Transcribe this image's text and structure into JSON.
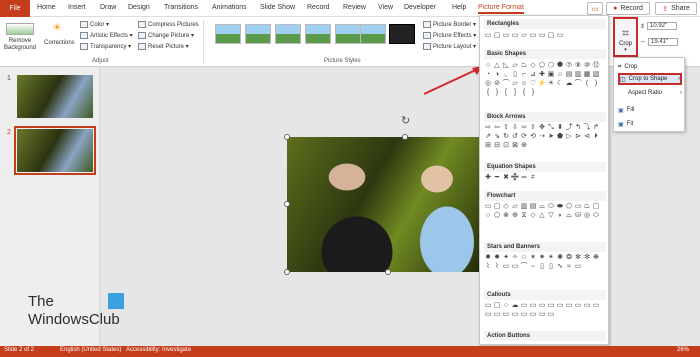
{
  "tabs": {
    "file": "File",
    "items": [
      "Home",
      "Insert",
      "Draw",
      "Design",
      "Transitions",
      "Animations",
      "Slide Show",
      "Record",
      "Review",
      "View",
      "Developer",
      "Help",
      "Picture Format"
    ],
    "record": "Record",
    "share": "Share"
  },
  "ribbon": {
    "remove_bg": "Remove\nBackground",
    "corrections": "Corrections",
    "color": "Color ▾",
    "artistic": "Artistic Effects ▾",
    "transparency": "Transparency ▾",
    "compress": "Compress Pictures",
    "change": "Change Picture ▾",
    "reset": "Reset Picture ▾",
    "group_adjust": "Adjust",
    "group_styles": "Picture Styles",
    "border": "Picture Border ▾",
    "effects": "Picture Effects ▾",
    "layout": "Picture Layout ▾",
    "height": "10.92\"",
    "width": "19.41\""
  },
  "crop": {
    "button": "Crop",
    "items": [
      "Crop",
      "Crop to Shape",
      "Aspect Ratio",
      "Fill",
      "Fit"
    ]
  },
  "shapes": {
    "sections": [
      "Rectangles",
      "Basic Shapes",
      "Block Arrows",
      "Equation Shapes",
      "Flowchart",
      "Stars and Banners",
      "Callouts",
      "Action Buttons"
    ]
  },
  "slides": [
    "1",
    "2"
  ],
  "watermark": [
    "The",
    "WindowsClub"
  ],
  "status": {
    "slide": "Slide 2 of 2",
    "lang": "English (United States)",
    "access": "Accessibility: Investigate",
    "zoom": "26%"
  },
  "colors": {
    "accent": "#c43e1c",
    "highlight": "#c42b2b"
  }
}
